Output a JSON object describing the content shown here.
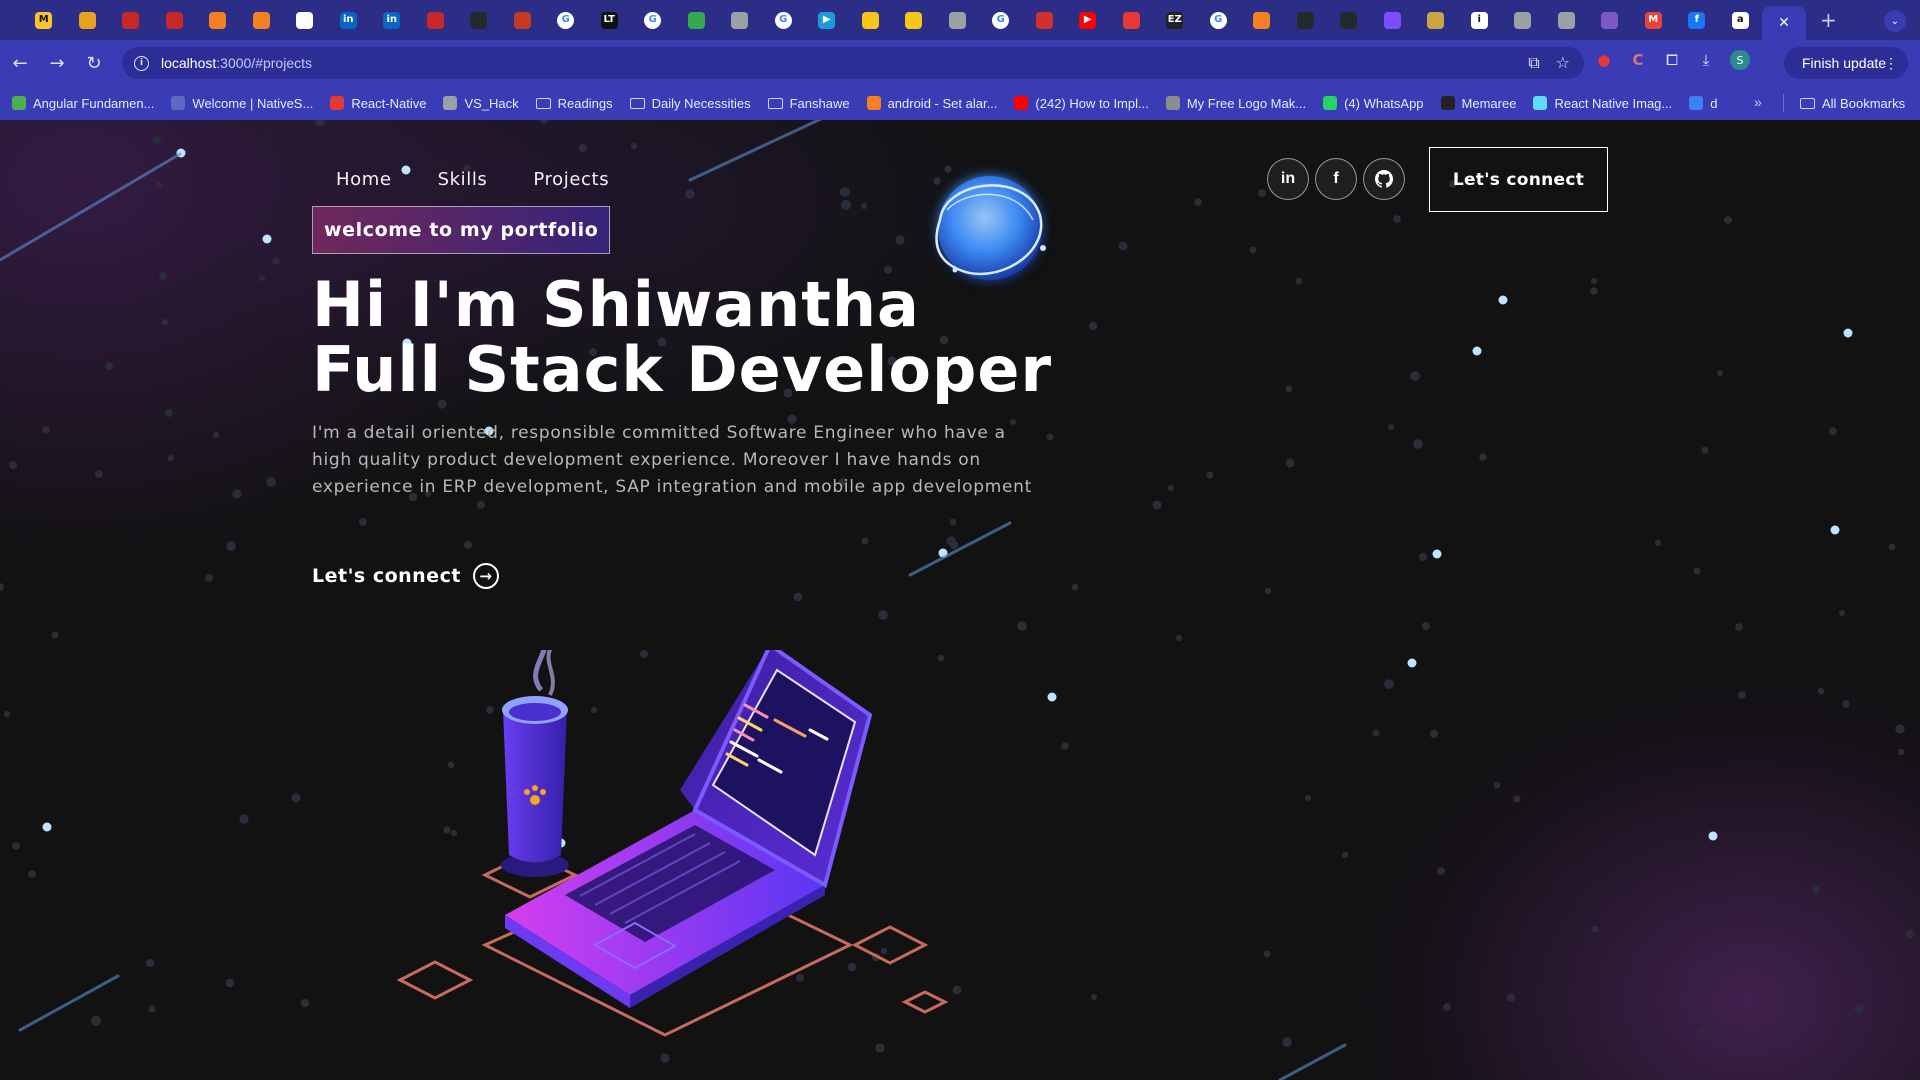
{
  "browser": {
    "tabs": [
      {
        "icon": "m-logo-icon",
        "label": "M",
        "color": "#f7c32e",
        "fg": "#111"
      },
      {
        "icon": "stackedit-icon",
        "label": "",
        "color": "#e9a21f"
      },
      {
        "icon": "red-circle-icon",
        "label": "",
        "color": "#c62828"
      },
      {
        "icon": "red-circle-icon",
        "label": "",
        "color": "#c62828"
      },
      {
        "icon": "stack-overflow-icon",
        "label": "",
        "color": "#f48024"
      },
      {
        "icon": "stack-overflow-icon",
        "label": "",
        "color": "#f48024"
      },
      {
        "icon": "openai-icon",
        "label": "",
        "color": "#ffffff",
        "fg": "#111"
      },
      {
        "icon": "linkedin-icon",
        "label": "in",
        "color": "#0a66c2"
      },
      {
        "icon": "linkedin-icon",
        "label": "in",
        "color": "#0a66c2"
      },
      {
        "icon": "app-icon",
        "label": "",
        "color": "#c62828"
      },
      {
        "icon": "github-icon",
        "label": "",
        "color": "#24292e"
      },
      {
        "icon": "app-icon",
        "label": "",
        "color": "#c23b22"
      },
      {
        "icon": "google-icon",
        "label": "G",
        "color": "#ffffff",
        "fg": "#4285f4"
      },
      {
        "icon": "lt-icon",
        "label": "LT",
        "color": "#111111"
      },
      {
        "icon": "google-icon",
        "label": "G",
        "color": "#ffffff",
        "fg": "#4285f4"
      },
      {
        "icon": "sheets-icon",
        "label": "",
        "color": "#34a853"
      },
      {
        "icon": "globe-icon",
        "label": "",
        "color": "#9aa0a6"
      },
      {
        "icon": "google-icon",
        "label": "G",
        "color": "#ffffff",
        "fg": "#4285f4"
      },
      {
        "icon": "play-icon",
        "label": "▶",
        "color": "#1a9ad6"
      },
      {
        "icon": "clapper-icon",
        "label": "",
        "color": "#f5c518"
      },
      {
        "icon": "clapper-icon",
        "label": "",
        "color": "#f5c518"
      },
      {
        "icon": "globe-icon",
        "label": "",
        "color": "#9aa0a6"
      },
      {
        "icon": "google-icon",
        "label": "G",
        "color": "#ffffff",
        "fg": "#4285f4"
      },
      {
        "icon": "target-icon",
        "label": "",
        "color": "#d32f2f"
      },
      {
        "icon": "youtube-icon",
        "label": "▶",
        "color": "#ff0000"
      },
      {
        "icon": "record-icon",
        "label": "",
        "color": "#e53935"
      },
      {
        "icon": "ez-icon",
        "label": "EZ",
        "color": "#222222"
      },
      {
        "icon": "google-icon",
        "label": "G",
        "color": "#ffffff",
        "fg": "#4285f4"
      },
      {
        "icon": "stack-overflow-icon",
        "label": "",
        "color": "#f48024"
      },
      {
        "icon": "github-icon",
        "label": "",
        "color": "#24292e"
      },
      {
        "icon": "github-icon",
        "label": "",
        "color": "#24292e"
      },
      {
        "icon": "box-icon",
        "label": "",
        "color": "#7c4dff"
      },
      {
        "icon": "app-icon",
        "label": "",
        "color": "#caa640"
      },
      {
        "icon": "info-icon",
        "label": "i",
        "color": "#ffffff",
        "fg": "#111"
      },
      {
        "icon": "globe-icon",
        "label": "",
        "color": "#9aa0a6"
      },
      {
        "icon": "globe-icon",
        "label": "",
        "color": "#9aa0a6"
      },
      {
        "icon": "app-icon",
        "label": "",
        "color": "#7e57c2"
      },
      {
        "icon": "gmail-icon",
        "label": "M",
        "color": "#ea4335"
      },
      {
        "icon": "facebook-icon",
        "label": "f",
        "color": "#1877f2"
      },
      {
        "icon": "amazon-icon",
        "label": "a",
        "color": "#ffffff",
        "fg": "#111"
      }
    ],
    "url_host": "localhost",
    "url_path": ":3000/#projects",
    "finish_update": "Finish update",
    "profile_initial": "S",
    "bookmarks": [
      {
        "label": "Angular Fundamen...",
        "type": "site",
        "color": "#4caf50"
      },
      {
        "label": "Welcome | NativeS...",
        "type": "site",
        "color": "#5c6bc0"
      },
      {
        "label": "React-Native",
        "type": "site",
        "color": "#e53935"
      },
      {
        "label": "VS_Hack",
        "type": "site",
        "color": "#9aa0a6"
      },
      {
        "label": "Readings",
        "type": "folder"
      },
      {
        "label": "Daily Necessities",
        "type": "folder"
      },
      {
        "label": "Fanshawe",
        "type": "folder"
      },
      {
        "label": "android - Set alar...",
        "type": "site",
        "color": "#f48024"
      },
      {
        "label": "(242) How to Impl...",
        "type": "site",
        "color": "#ff0000"
      },
      {
        "label": "My Free Logo Mak...",
        "type": "site",
        "color": "#8d8d8d"
      },
      {
        "label": "(4) WhatsApp",
        "type": "site",
        "color": "#25d366"
      },
      {
        "label": "Memaree",
        "type": "site",
        "color": "#222222"
      },
      {
        "label": "React Native Imag...",
        "type": "site",
        "color": "#61dafb"
      },
      {
        "label": "d",
        "type": "site",
        "color": "#3b82f6"
      }
    ],
    "all_bookmarks": "All Bookmarks"
  },
  "page": {
    "nav": [
      "Home",
      "Skills",
      "Projects"
    ],
    "social": {
      "linkedin": "in",
      "facebook": "f"
    },
    "connect_button": "Let's connect",
    "tagline": "welcome to my portfolio",
    "headline": "Hi I'm Shiwantha Full Stack Developer",
    "description": "I'm a detail oriented, responsible committed Software Engineer who have a high quality product development experience. Moreover I have hands on experience in ERP development, SAP integration and mobile app development",
    "cta": "Let's connect",
    "colors": {
      "background": "#121212",
      "tagline_gradient_start": "#aa367c",
      "tagline_gradient_end": "#4a2fbd",
      "accent_purple": "#7b2ff7",
      "star_blue": "#9fd4ff"
    }
  }
}
